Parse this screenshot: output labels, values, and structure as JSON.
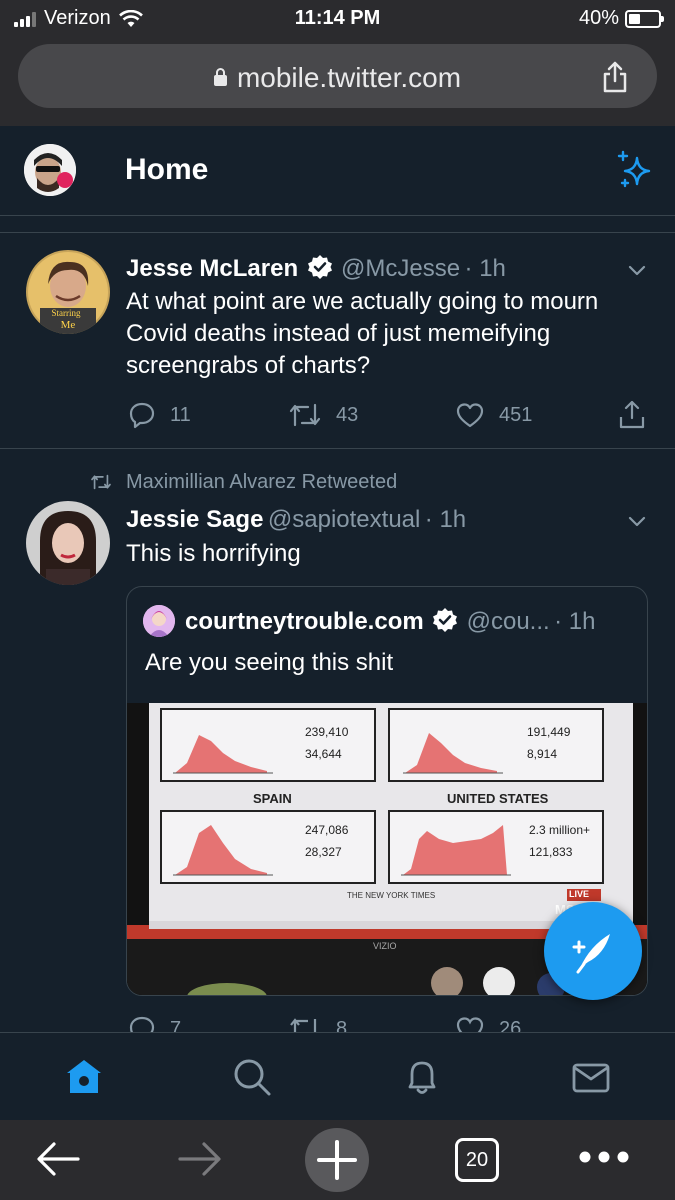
{
  "status_bar": {
    "carrier": "Verizon",
    "time": "11:14 PM",
    "battery_percent": "40%",
    "battery_level": 0.4
  },
  "browser": {
    "url": "mobile.twitter.com",
    "tab_count": "20"
  },
  "header": {
    "title": "Home"
  },
  "tweets": [
    {
      "name": "Jesse McLaren",
      "handle": "@McJesse",
      "time": "· 1h",
      "verified": true,
      "text": "At what point are we actually going to mourn Covid deaths instead of just memeifying screengrabs of charts?",
      "replies": "11",
      "retweets": "43",
      "likes": "451"
    },
    {
      "retweeted_by": "Maximillian Alvarez Retweeted",
      "name": "Jessie Sage",
      "handle": "@sapiotextual",
      "time": "· 1h",
      "text": "This is horrifying",
      "replies": "7",
      "retweets": "8",
      "likes": "26",
      "quote": {
        "name": "courtneytrouble.com",
        "handle": "@cou...",
        "time": "· 1h",
        "verified": true,
        "text": "Are you seeing this shit",
        "photo": {
          "panels": [
            {
              "title": "",
              "total_cases": "239,410",
              "deaths": "34,644"
            },
            {
              "title": "",
              "total_cases": "191,449",
              "deaths": "8,914"
            },
            {
              "title": "SPAIN",
              "total_cases": "247,086",
              "deaths": "28,327"
            },
            {
              "title": "UNITED STATES",
              "total_cases": "2.3 million+",
              "deaths": "121,833"
            }
          ],
          "source": "THE NEW YORK TIMES",
          "live_badge": "LIVE",
          "network": "MSN",
          "tv_brand": "VIZIO"
        }
      }
    }
  ],
  "colors": {
    "background": "#15202b",
    "accent": "#1d9bf0",
    "muted": "#8899a6",
    "divider": "#38444d"
  }
}
